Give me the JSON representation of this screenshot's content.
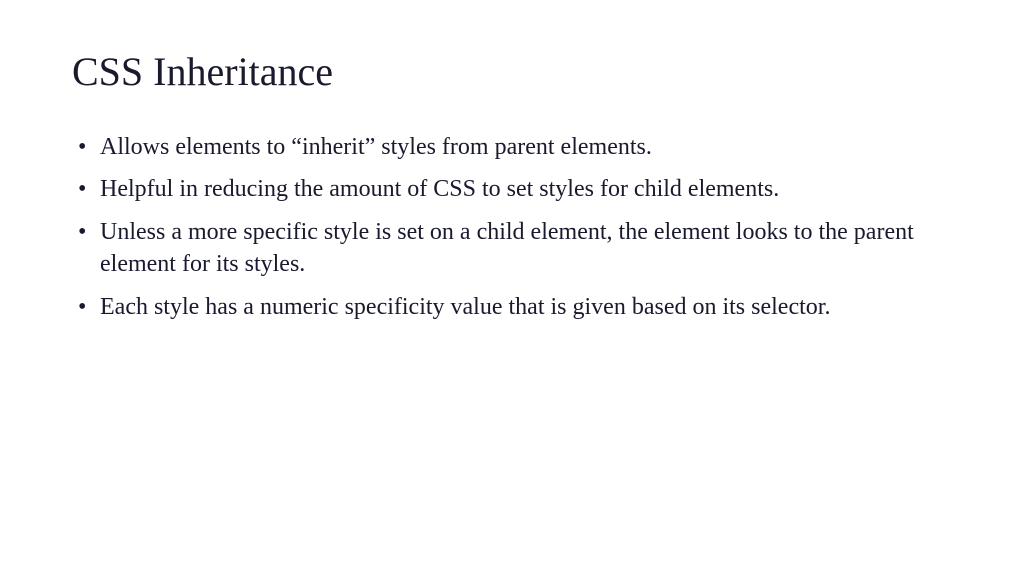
{
  "slide": {
    "title": "CSS Inheritance",
    "bullets": [
      "Allows elements to “inherit” styles from parent elements.",
      "Helpful in reducing the amount of CSS to set styles for child elements.",
      "Unless a more specific style is set on a child element, the element looks to the parent element for its styles.",
      "Each style has a numeric specificity value that is given based on its selector."
    ]
  }
}
